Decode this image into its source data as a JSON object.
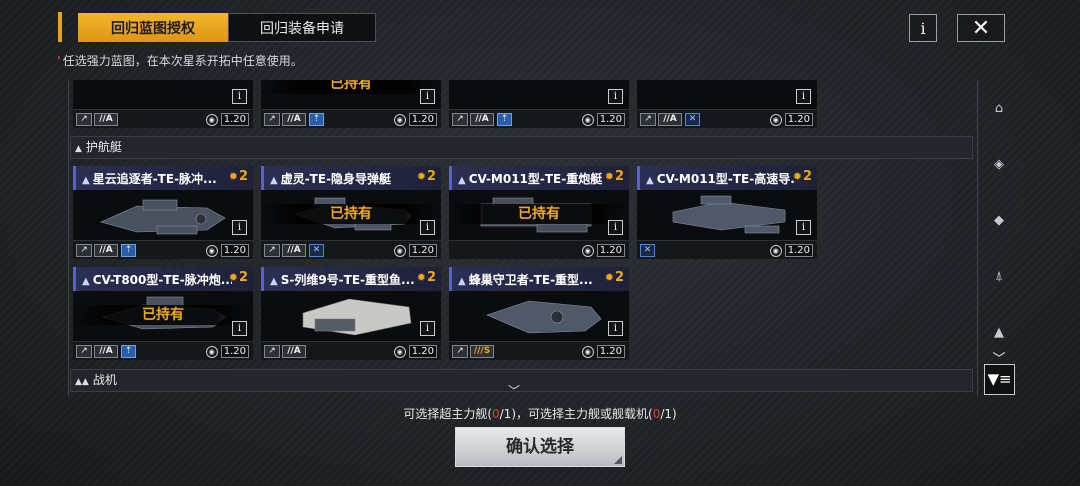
{
  "tabs": [
    {
      "label": "回归蓝图授权",
      "active": true
    },
    {
      "label": "回归装备申请",
      "active": false
    }
  ],
  "header": {
    "info_label": "i",
    "close_label": "✕"
  },
  "notice": {
    "mark": "'",
    "text": "任选强力蓝图，在本次星系开拓中任意使用。"
  },
  "colors": {
    "accent": "#f2a81c",
    "highlight_red": "#e1412a",
    "card_head": "#2b2f52",
    "tech_blue": "#2a5ea8"
  },
  "top_row_cards": [
    {
      "owned_label": "已持有",
      "size": "//A",
      "cmd_value": "1.20",
      "chips": [
        "type",
        "size",
        "tech"
      ]
    },
    {
      "size": "//A",
      "cmd_value": "1.20",
      "chips": [
        "type",
        "size",
        "tech"
      ]
    },
    {
      "size": "//A",
      "cmd_value": "1.20",
      "chips": [
        "type",
        "size",
        "cross"
      ]
    }
  ],
  "top_row_first": {
    "size": "//A",
    "cmd_value": "1.20"
  },
  "sections": {
    "escort": "护航艇",
    "fighter": "战机"
  },
  "escort_cards": [
    {
      "name": "星云追逐者-TE-脉冲...",
      "cost": "2",
      "owned": false,
      "size": "//A",
      "cmd_value": "1.20"
    },
    {
      "name": "虚灵-TE-隐身导弹艇",
      "cost": "2",
      "owned": true,
      "owned_label": "已持有",
      "size": "//A",
      "cmd_value": "1.20"
    },
    {
      "name": "CV-M011型-TE-重炮艇",
      "cost": "2",
      "owned": true,
      "owned_label": "已持有",
      "size": "",
      "cmd_value": "1.20"
    },
    {
      "name": "CV-M011型-TE-高速导...",
      "cost": "2",
      "owned": false,
      "size": "",
      "cmd_value": "1.20"
    },
    {
      "name": "CV-T800型-TE-脉冲炮...",
      "cost": "2",
      "owned": true,
      "owned_label": "已持有",
      "size": "//A",
      "cmd_value": "1.20"
    },
    {
      "name": "S-列维9号-TE-重型鱼...",
      "cost": "2",
      "owned": false,
      "size": "//A",
      "cmd_value": "1.20"
    },
    {
      "name": "蜂巢守卫者-TE-重型...",
      "cost": "2",
      "owned": false,
      "size": "///S",
      "cmd_value": "1.20"
    }
  ],
  "card_info_label": "i",
  "rail_icons": [
    "cruiser-icon",
    "carrier-icon",
    "destroyer-icon",
    "frigate-icon",
    "corvette-icon"
  ],
  "filter_label": "▼≡",
  "summary": {
    "part1": "可选择超主力舰(",
    "zero1": "0",
    "part2": "/1)，可选择主力舰或舰载机(",
    "zero2": "0",
    "part3": "/1)"
  },
  "confirm_label": "确认选择"
}
